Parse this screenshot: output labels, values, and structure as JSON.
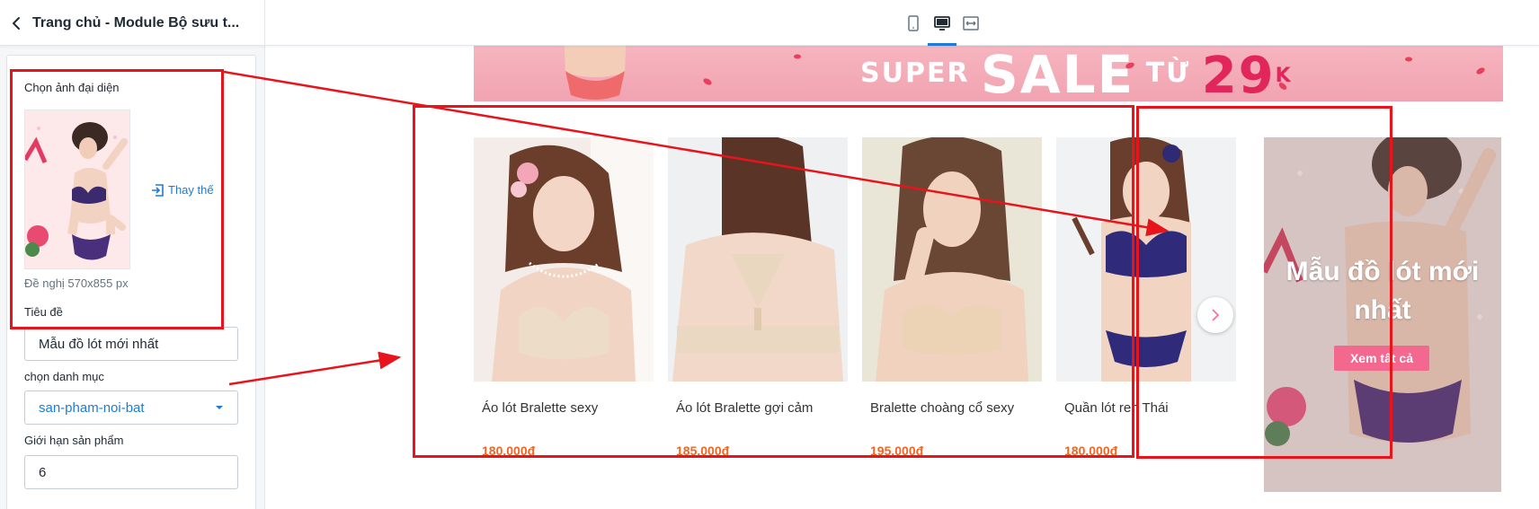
{
  "header": {
    "title": "Trang chủ - Module Bộ sưu t...",
    "devices": [
      {
        "name": "mobile",
        "active": false
      },
      {
        "name": "desktop",
        "active": true
      },
      {
        "name": "fullwidth",
        "active": false
      }
    ]
  },
  "settings": {
    "image_label": "Chọn ảnh đại diện",
    "replace_label": "Thay thế",
    "size_hint": "Đề nghị 570x855 px",
    "title_label": "Tiêu đề",
    "title_value": "Mẫu đồ lót mới nhất",
    "category_label": "chọn danh mục",
    "category_value": "san-pham-noi-bat",
    "limit_label": "Giới hạn sản phẩm",
    "limit_value": "6"
  },
  "preview": {
    "banner": {
      "text_small": "SUPER",
      "text_big": "SALE",
      "text_mid": "TỪ",
      "text_price": "29",
      "text_unit": "K"
    },
    "products": [
      {
        "name": "Áo lót Bralette sexy",
        "price": "180.000đ"
      },
      {
        "name": "Áo lót Bralette gợi cảm",
        "price": "185.000đ"
      },
      {
        "name": "Bralette choàng cổ sexy",
        "price": "195.000đ"
      },
      {
        "name": "Quần lót ren Thái",
        "price": "180.000đ"
      }
    ],
    "promo": {
      "title": "Mẫu đồ lót mới nhất",
      "button": "Xem tất cả"
    }
  },
  "colors": {
    "accent": "#1d7bd6",
    "price": "#f26522",
    "annotation": "#e8141c",
    "promo_button": "#f2688e"
  }
}
